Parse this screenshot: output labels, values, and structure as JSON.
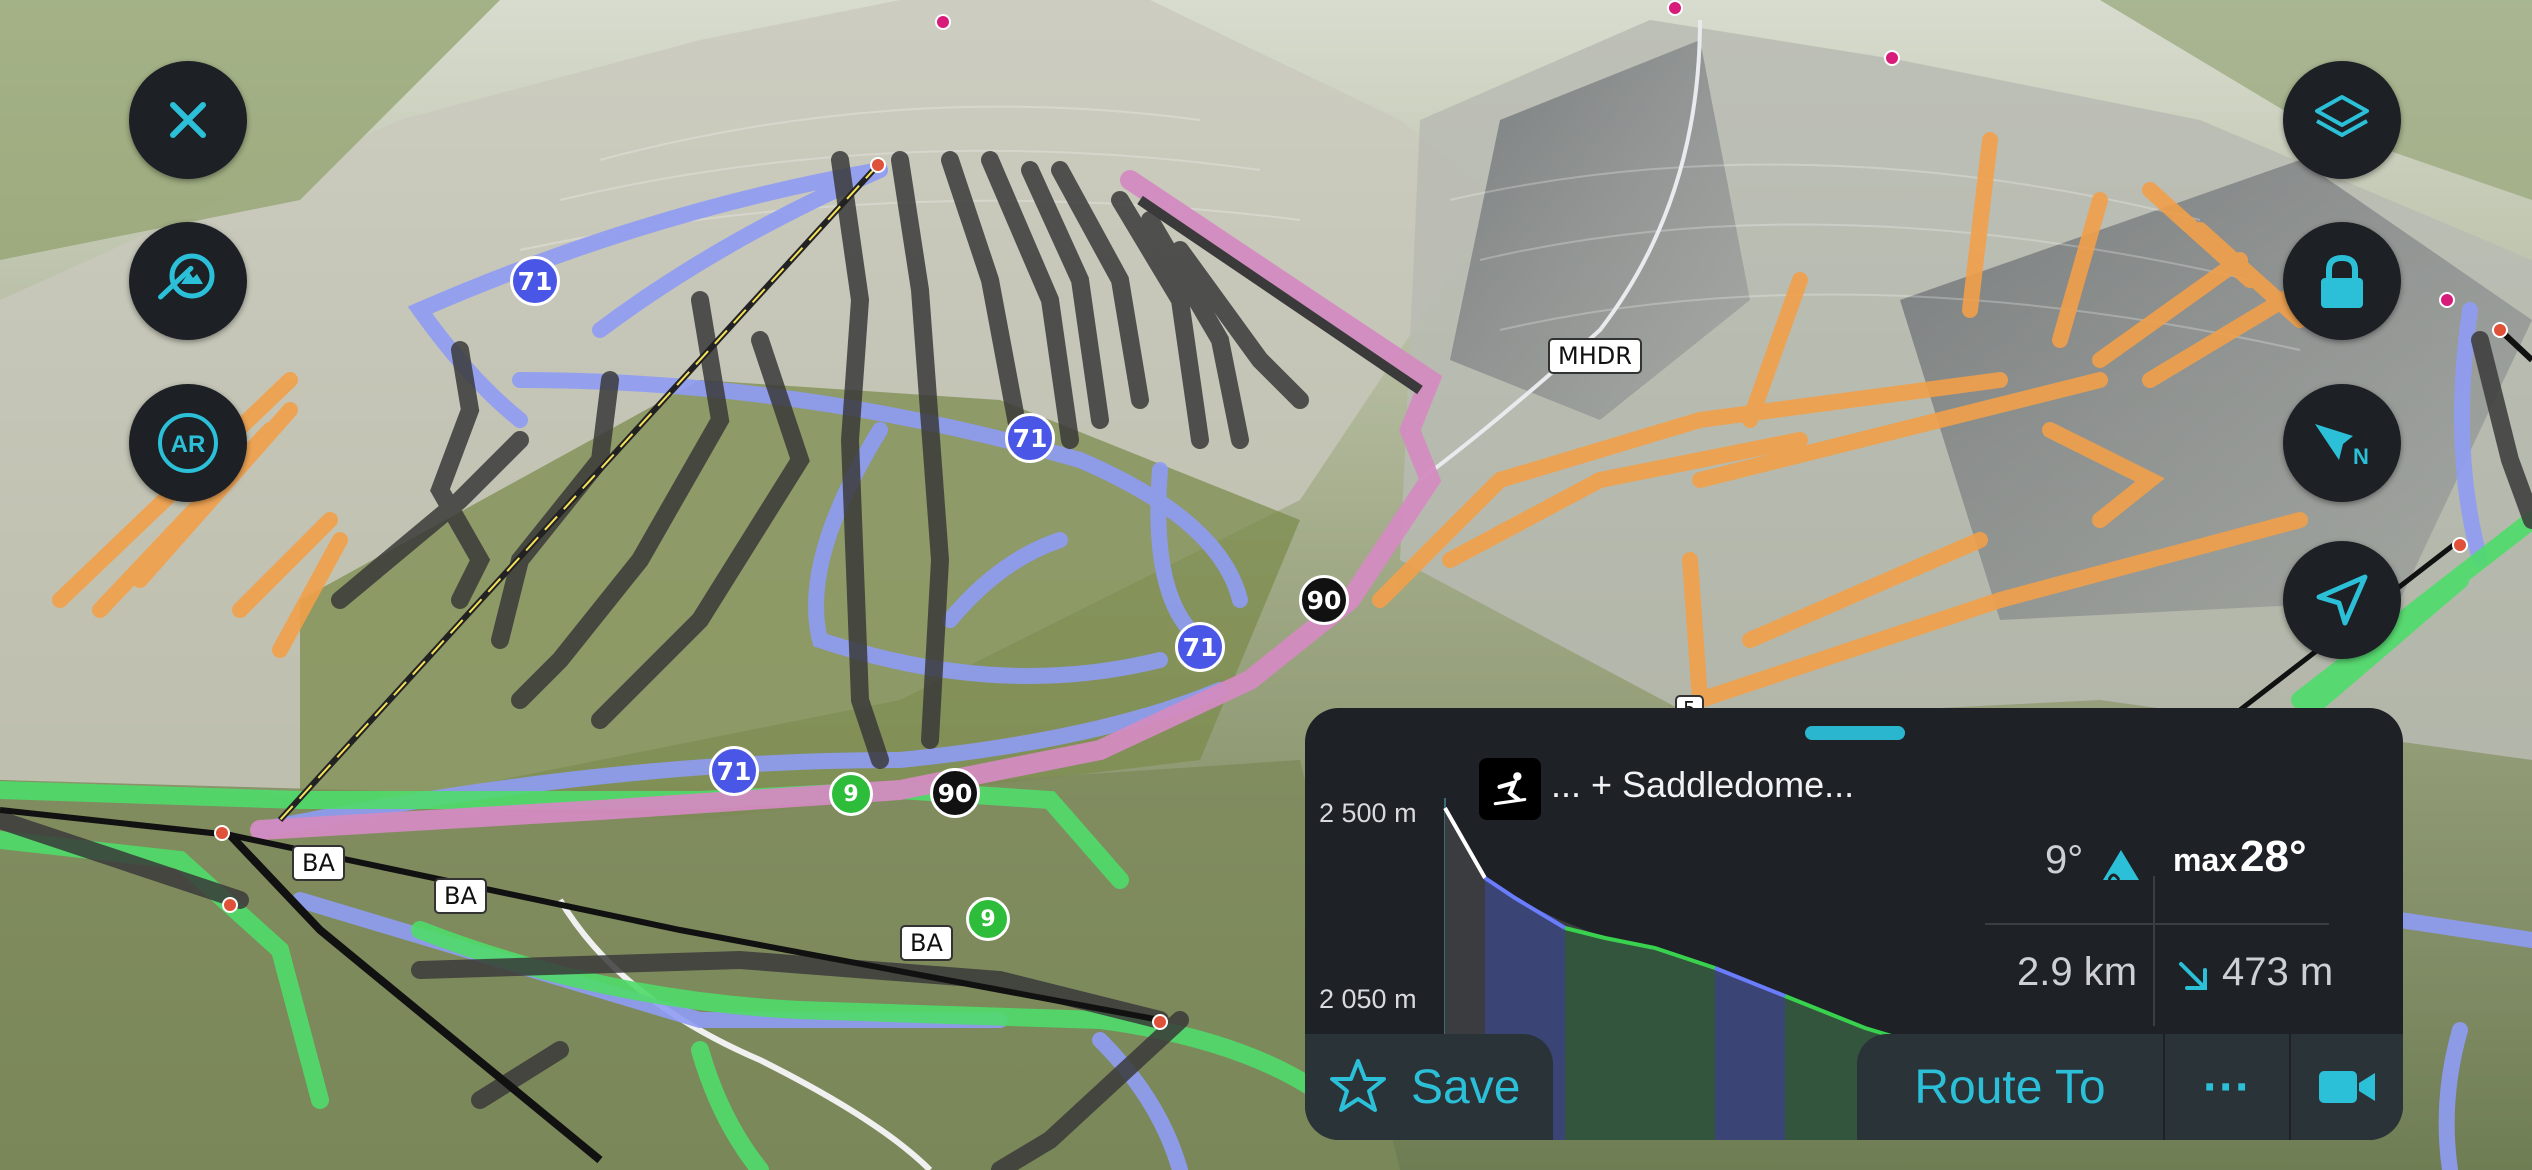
{
  "map": {
    "trail_numbers": [
      {
        "text": "71",
        "kind": "blue"
      },
      {
        "text": "71",
        "kind": "blue"
      },
      {
        "text": "71",
        "kind": "blue"
      },
      {
        "text": "71",
        "kind": "blue"
      },
      {
        "text": "90",
        "kind": "black"
      },
      {
        "text": "90",
        "kind": "black"
      },
      {
        "text": "9",
        "kind": "green"
      },
      {
        "text": "9",
        "kind": "green"
      }
    ],
    "tags": [
      "MHDR",
      "BA",
      "BA",
      "BA",
      "5"
    ]
  },
  "left_controls": {
    "close_icon": "close-icon",
    "search_icon": "mountain-search-icon",
    "ar_label": "AR"
  },
  "right_controls": {
    "layers_icon": "layers-icon",
    "lock_icon": "lock-icon",
    "compass_label": "N",
    "locate_icon": "navigation-arrow-icon"
  },
  "panel": {
    "trail_name": "... + Saddledome...",
    "elev_top": "2 500 m",
    "elev_bottom": "2 050 m",
    "avg_slope": "9°",
    "max_slope_label": "max",
    "max_slope_value": "28°",
    "distance": "2.9 km",
    "descent": "473 m",
    "save_label": "Save",
    "route_label": "Route To",
    "more_label": "···"
  },
  "colors": {
    "panel_bg": "#1e2125",
    "accent": "#2bc0d8",
    "blue_run": "#8f9cf4",
    "green_run": "#4fdc6a",
    "black_run": "#3a3a3a",
    "orange_run": "#f2a04a",
    "selected_route": "#d38bc0"
  }
}
